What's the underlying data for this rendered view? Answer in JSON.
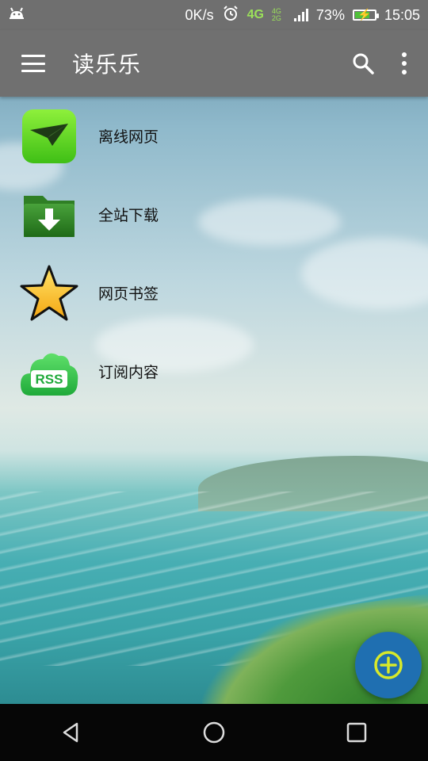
{
  "status_bar": {
    "speed": "0K/s",
    "network_4g": "4G",
    "network_4g_2g": "4G 2G",
    "battery": "73%",
    "time": "15:05"
  },
  "app_bar": {
    "title": "读乐乐",
    "icons": [
      "menu-icon",
      "search-icon",
      "overflow-menu-icon"
    ]
  },
  "menu": {
    "items": [
      {
        "label": "离线网页",
        "icon": "paper-plane-icon"
      },
      {
        "label": "全站下载",
        "icon": "folder-download-icon"
      },
      {
        "label": "网页书签",
        "icon": "star-icon"
      },
      {
        "label": "订阅内容",
        "icon": "rss-icon",
        "icon_text": "RSS"
      }
    ]
  },
  "fab": {
    "icon": "add-circle-icon",
    "color": "#1f6fb1"
  },
  "nav_bar": {
    "icons": [
      "back-icon",
      "home-icon",
      "recents-icon"
    ]
  },
  "colors": {
    "app_bar": "#707070",
    "status_bar": "#6f6f6f",
    "fab": "#1f6fb1"
  }
}
